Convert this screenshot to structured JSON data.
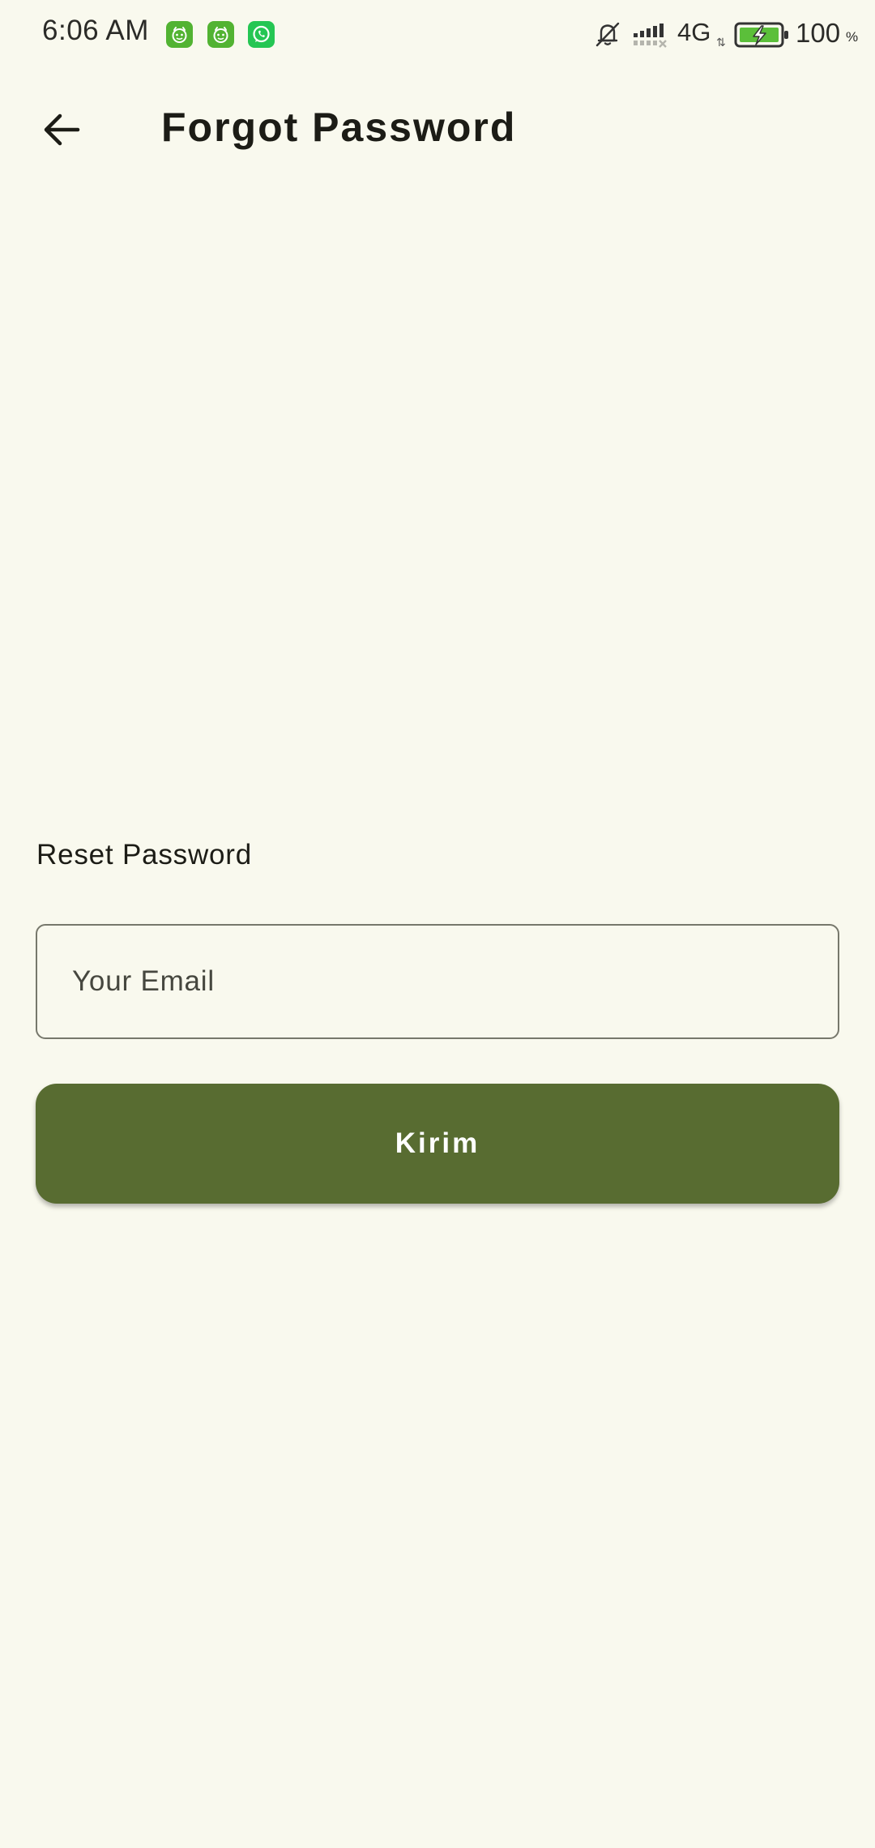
{
  "status_bar": {
    "time": "6:06 AM",
    "notification_icons": [
      "mascot-app-icon",
      "mascot-app-icon",
      "whatsapp-icon"
    ],
    "icons": [
      "bell-muted-icon",
      "signal-no-service-icon",
      "battery-charging-icon"
    ],
    "network": "4G",
    "battery_percent": "100",
    "battery_unit": "%"
  },
  "app_bar": {
    "back_icon": "arrow-left-icon",
    "title": "Forgot Password"
  },
  "form": {
    "section_label": "Reset Password",
    "email": {
      "placeholder": "Your Email",
      "value": ""
    },
    "submit_label": "Kirim"
  },
  "colors": {
    "background": "#f9f9ee",
    "primary": "#586c31",
    "outline": "#77786c",
    "on_primary": "#ffffff",
    "text": "#1c1c16"
  }
}
